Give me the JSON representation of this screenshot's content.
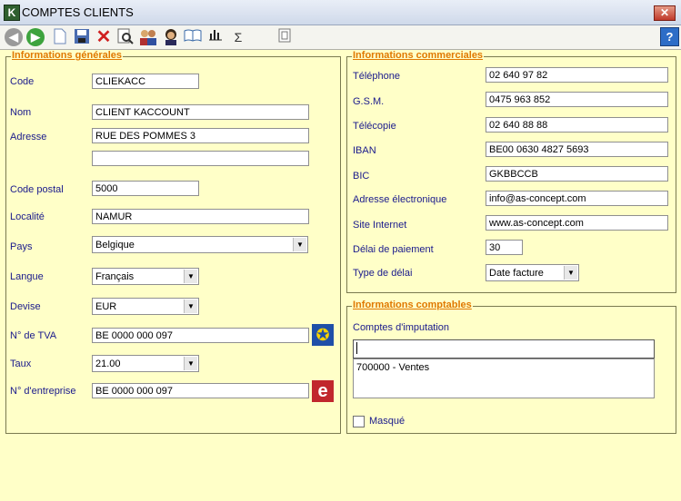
{
  "window": {
    "title": "COMPTES CLIENTS",
    "app_icon": "K",
    "close_glyph": "✕"
  },
  "toolbar": {
    "icons": [
      "back-icon",
      "forward-icon",
      "new-document-icon",
      "save-icon",
      "delete-icon",
      "preview-icon",
      "users-icon",
      "contact-icon",
      "book-icon",
      "chart-icon",
      "sum-icon",
      "report-icon"
    ],
    "sum_glyph": "Σ",
    "help_glyph": "?"
  },
  "general": {
    "legend": "Informations générales",
    "code_label": "Code",
    "code_value": "CLIEKACC",
    "nom_label": "Nom",
    "nom_value": "CLIENT KACCOUNT",
    "adresse_label": "Adresse",
    "adresse_value": "RUE DES POMMES 3",
    "adresse2_value": "",
    "cp_label": "Code postal",
    "cp_value": "5000",
    "localite_label": "Localité",
    "localite_value": "NAMUR",
    "pays_label": "Pays",
    "pays_value": "Belgique",
    "langue_label": "Langue",
    "langue_value": "Français",
    "devise_label": "Devise",
    "devise_value": "EUR",
    "tva_label": "N° de TVA",
    "tva_value": "BE 0000 000 097",
    "taux_label": "Taux",
    "taux_value": "21.00",
    "entreprise_label": "N° d'entreprise",
    "entreprise_value": "BE 0000 000 097"
  },
  "commercial": {
    "legend": "Informations commerciales",
    "tel_label": "Téléphone",
    "tel_value": "02 640 97 82",
    "gsm_label": "G.S.M.",
    "gsm_value": "0475 963 852",
    "fax_label": "Télécopie",
    "fax_value": "02 640 88 88",
    "iban_label": "IBAN",
    "iban_value": "BE00 0630 4827 5693",
    "bic_label": "BIC",
    "bic_value": "GKBBCCB",
    "email_label": "Adresse électronique",
    "email_value": "info@as-concept.com",
    "site_label": "Site Internet",
    "site_value": "www.as-concept.com",
    "delai_label": "Délai de paiement",
    "delai_value": "30",
    "type_delai_label": "Type de délai",
    "type_delai_value": "Date facture"
  },
  "comptable": {
    "legend": "Informations comptables",
    "imputation_label": "Comptes d'imputation",
    "imputation_input": "",
    "imputation_items": [
      "700000 - Ventes"
    ],
    "masque_label": "Masqué",
    "masque_checked": false
  }
}
